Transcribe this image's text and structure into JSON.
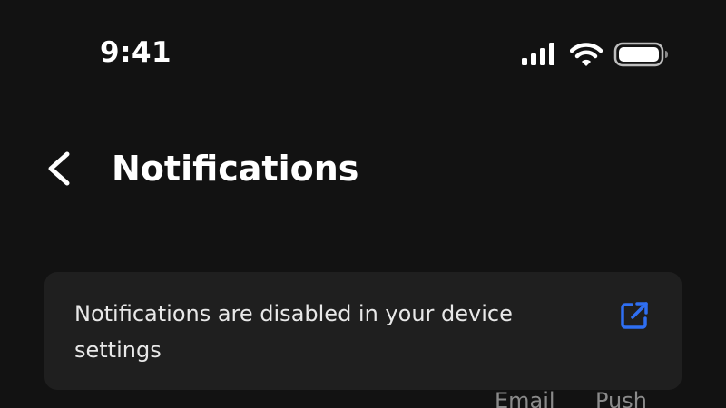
{
  "status_bar": {
    "time": "9:41",
    "icons": [
      "cellular-signal-icon",
      "wifi-icon",
      "battery-icon"
    ]
  },
  "header": {
    "back_icon": "chevron-left-icon",
    "title": "Notifications"
  },
  "banner": {
    "message": "Notifications are disabled in your device settings",
    "link_icon": "external-link-icon",
    "accent_color": "#2f6ff2"
  },
  "columns": {
    "email": "Email",
    "push": "Push"
  },
  "colors": {
    "background": "#121212",
    "card": "#1f1f1f",
    "text": "#ffffff",
    "muted": "#8a8a8a"
  }
}
